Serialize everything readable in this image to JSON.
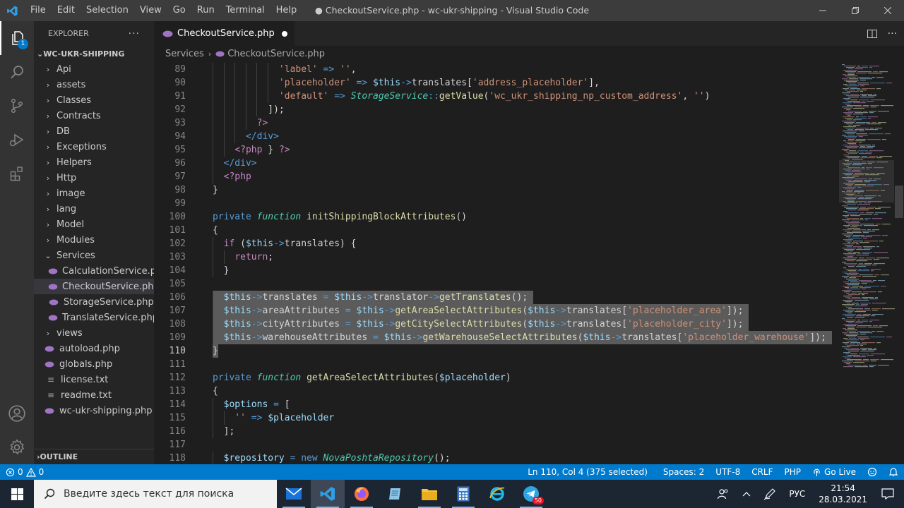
{
  "window": {
    "title": "● CheckoutService.php - wc-ukr-shipping - Visual Studio Code",
    "menu": [
      "File",
      "Edit",
      "Selection",
      "View",
      "Go",
      "Run",
      "Terminal",
      "Help"
    ]
  },
  "activity": {
    "explorer_badge": "1"
  },
  "sidebar": {
    "header": "EXPLORER",
    "more": "···",
    "root": "WC-UKR-SHIPPING",
    "items": [
      {
        "label": "Api",
        "type": "folder"
      },
      {
        "label": "assets",
        "type": "folder"
      },
      {
        "label": "Classes",
        "type": "folder"
      },
      {
        "label": "Contracts",
        "type": "folder"
      },
      {
        "label": "DB",
        "type": "folder"
      },
      {
        "label": "Exceptions",
        "type": "folder"
      },
      {
        "label": "Helpers",
        "type": "folder"
      },
      {
        "label": "Http",
        "type": "folder"
      },
      {
        "label": "image",
        "type": "folder"
      },
      {
        "label": "lang",
        "type": "folder"
      },
      {
        "label": "Model",
        "type": "folder"
      },
      {
        "label": "Modules",
        "type": "folder"
      },
      {
        "label": "Services",
        "type": "folder-open"
      },
      {
        "label": "CalculationService.p...",
        "type": "php-child"
      },
      {
        "label": "CheckoutService.php",
        "type": "php-child",
        "selected": true
      },
      {
        "label": "StorageService.php",
        "type": "php-child"
      },
      {
        "label": "TranslateService.php",
        "type": "php-child"
      },
      {
        "label": "views",
        "type": "folder"
      },
      {
        "label": "autoload.php",
        "type": "php"
      },
      {
        "label": "globals.php",
        "type": "php"
      },
      {
        "label": "license.txt",
        "type": "txt"
      },
      {
        "label": "readme.txt",
        "type": "txt"
      },
      {
        "label": "wc-ukr-shipping.php",
        "type": "php"
      }
    ],
    "outline": "OUTLINE"
  },
  "editor": {
    "tab_label": "CheckoutService.php",
    "breadcrumb": [
      "Services",
      "CheckoutService.php"
    ],
    "current_line": 110,
    "lines": [
      {
        "n": 89,
        "i": 6,
        "s": false,
        "t": [
          [
            "str",
            "'label'"
          ],
          [
            "op",
            " "
          ],
          [
            "kw",
            "=>"
          ],
          [
            "op",
            " "
          ],
          [
            "str",
            "''"
          ],
          [
            "op",
            ","
          ]
        ]
      },
      {
        "n": 90,
        "i": 6,
        "s": false,
        "t": [
          [
            "str",
            "'placeholder'"
          ],
          [
            "op",
            " "
          ],
          [
            "kw",
            "=>"
          ],
          [
            "op",
            " "
          ],
          [
            "var",
            "$this"
          ],
          [
            "kw",
            "->"
          ],
          [
            "op",
            "translates["
          ],
          [
            "str",
            "'address_placeholder'"
          ],
          [
            "op",
            "],"
          ]
        ]
      },
      {
        "n": 91,
        "i": 6,
        "s": false,
        "t": [
          [
            "str",
            "'default'"
          ],
          [
            "op",
            " "
          ],
          [
            "kw",
            "=>"
          ],
          [
            "op",
            " "
          ],
          [
            "cls",
            "StorageService"
          ],
          [
            "kw",
            "::"
          ],
          [
            "fn",
            "getValue"
          ],
          [
            "op",
            "("
          ],
          [
            "str",
            "'wc_ukr_shipping_np_custom_address'"
          ],
          [
            "op",
            ", "
          ],
          [
            "str",
            "''"
          ],
          [
            "op",
            ")"
          ]
        ]
      },
      {
        "n": 92,
        "i": 5,
        "s": false,
        "t": [
          [
            "op",
            "]);"
          ]
        ]
      },
      {
        "n": 93,
        "i": 4,
        "s": false,
        "t": [
          [
            "ctl",
            "?>"
          ]
        ]
      },
      {
        "n": 94,
        "i": 3,
        "s": false,
        "t": [
          [
            "tag",
            "</div>"
          ]
        ]
      },
      {
        "n": 95,
        "i": 2,
        "s": false,
        "t": [
          [
            "ctl",
            "<?php"
          ],
          [
            "op",
            " } "
          ],
          [
            "ctl",
            "?>"
          ]
        ]
      },
      {
        "n": 96,
        "i": 1,
        "s": false,
        "t": [
          [
            "tag",
            "</div>"
          ]
        ]
      },
      {
        "n": 97,
        "i": 1,
        "s": false,
        "t": [
          [
            "ctl",
            "<?php"
          ]
        ]
      },
      {
        "n": 98,
        "i": 0,
        "s": false,
        "t": [
          [
            "op",
            "}"
          ]
        ]
      },
      {
        "n": 99,
        "i": 0,
        "s": false,
        "t": []
      },
      {
        "n": 100,
        "i": 0,
        "s": false,
        "t": [
          [
            "kw",
            "private"
          ],
          [
            "op",
            " "
          ],
          [
            "cls",
            "function"
          ],
          [
            "op",
            " "
          ],
          [
            "fn",
            "initShippingBlockAttributes"
          ],
          [
            "op",
            "()"
          ]
        ]
      },
      {
        "n": 101,
        "i": 0,
        "s": false,
        "t": [
          [
            "op",
            "{"
          ]
        ]
      },
      {
        "n": 102,
        "i": 1,
        "s": false,
        "t": [
          [
            "ctl",
            "if"
          ],
          [
            "op",
            " ("
          ],
          [
            "var",
            "$this"
          ],
          [
            "kw",
            "->"
          ],
          [
            "op",
            "translates) {"
          ]
        ]
      },
      {
        "n": 103,
        "i": 2,
        "s": false,
        "t": [
          [
            "ctl",
            "return"
          ],
          [
            "op",
            ";"
          ]
        ]
      },
      {
        "n": 104,
        "i": 1,
        "s": false,
        "t": [
          [
            "op",
            "}"
          ]
        ]
      },
      {
        "n": 105,
        "i": 0,
        "s": false,
        "t": []
      },
      {
        "n": 106,
        "i": 1,
        "s": true,
        "t": [
          [
            "var",
            "$this"
          ],
          [
            "kw",
            "->"
          ],
          [
            "op",
            "translates "
          ],
          [
            "kw",
            "="
          ],
          [
            "op",
            " "
          ],
          [
            "var",
            "$this"
          ],
          [
            "kw",
            "->"
          ],
          [
            "op",
            "translator"
          ],
          [
            "kw",
            "->"
          ],
          [
            "fn",
            "getTranslates"
          ],
          [
            "op",
            "();"
          ]
        ]
      },
      {
        "n": 107,
        "i": 1,
        "s": true,
        "t": [
          [
            "var",
            "$this"
          ],
          [
            "kw",
            "->"
          ],
          [
            "op",
            "areaAttributes "
          ],
          [
            "kw",
            "="
          ],
          [
            "op",
            " "
          ],
          [
            "var",
            "$this"
          ],
          [
            "kw",
            "->"
          ],
          [
            "fn",
            "getAreaSelectAttributes"
          ],
          [
            "op",
            "("
          ],
          [
            "var",
            "$this"
          ],
          [
            "kw",
            "->"
          ],
          [
            "op",
            "translates["
          ],
          [
            "str",
            "'placeholder_area'"
          ],
          [
            "op",
            "]);"
          ]
        ]
      },
      {
        "n": 108,
        "i": 1,
        "s": true,
        "t": [
          [
            "var",
            "$this"
          ],
          [
            "kw",
            "->"
          ],
          [
            "op",
            "cityAttributes "
          ],
          [
            "kw",
            "="
          ],
          [
            "op",
            " "
          ],
          [
            "var",
            "$this"
          ],
          [
            "kw",
            "->"
          ],
          [
            "fn",
            "getCitySelectAttributes"
          ],
          [
            "op",
            "("
          ],
          [
            "var",
            "$this"
          ],
          [
            "kw",
            "->"
          ],
          [
            "op",
            "translates["
          ],
          [
            "str",
            "'placeholder_city'"
          ],
          [
            "op",
            "]);"
          ]
        ]
      },
      {
        "n": 109,
        "i": 1,
        "s": true,
        "t": [
          [
            "var",
            "$this"
          ],
          [
            "kw",
            "->"
          ],
          [
            "op",
            "warehouseAttributes "
          ],
          [
            "kw",
            "="
          ],
          [
            "op",
            " "
          ],
          [
            "var",
            "$this"
          ],
          [
            "kw",
            "->"
          ],
          [
            "fn",
            "getWarehouseSelectAttributes"
          ],
          [
            "op",
            "("
          ],
          [
            "var",
            "$this"
          ],
          [
            "kw",
            "->"
          ],
          [
            "op",
            "translates["
          ],
          [
            "str",
            "'placeholder_warehouse'"
          ],
          [
            "op",
            "]);"
          ]
        ]
      },
      {
        "n": 110,
        "i": 0,
        "s": true,
        "t": [
          [
            "op",
            "}"
          ]
        ]
      },
      {
        "n": 111,
        "i": 0,
        "s": false,
        "t": []
      },
      {
        "n": 112,
        "i": 0,
        "s": false,
        "t": [
          [
            "kw",
            "private"
          ],
          [
            "op",
            " "
          ],
          [
            "cls",
            "function"
          ],
          [
            "op",
            " "
          ],
          [
            "fn",
            "getAreaSelectAttributes"
          ],
          [
            "op",
            "("
          ],
          [
            "var",
            "$placeholder"
          ],
          [
            "op",
            ")"
          ]
        ]
      },
      {
        "n": 113,
        "i": 0,
        "s": false,
        "t": [
          [
            "op",
            "{"
          ]
        ]
      },
      {
        "n": 114,
        "i": 1,
        "s": false,
        "t": [
          [
            "var",
            "$options"
          ],
          [
            "op",
            " "
          ],
          [
            "kw",
            "="
          ],
          [
            "op",
            " ["
          ]
        ]
      },
      {
        "n": 115,
        "i": 2,
        "s": false,
        "t": [
          [
            "str",
            "''"
          ],
          [
            "op",
            " "
          ],
          [
            "kw",
            "=>"
          ],
          [
            "op",
            " "
          ],
          [
            "var",
            "$placeholder"
          ]
        ]
      },
      {
        "n": 116,
        "i": 1,
        "s": false,
        "t": [
          [
            "op",
            "];"
          ]
        ]
      },
      {
        "n": 117,
        "i": 0,
        "s": false,
        "t": []
      },
      {
        "n": 118,
        "i": 1,
        "s": false,
        "t": [
          [
            "var",
            "$repository"
          ],
          [
            "op",
            " "
          ],
          [
            "kw",
            "="
          ],
          [
            "op",
            " "
          ],
          [
            "kw",
            "new"
          ],
          [
            "op",
            " "
          ],
          [
            "cls",
            "NovaPoshtaRepository"
          ],
          [
            "op",
            "();"
          ]
        ]
      }
    ]
  },
  "statusbar": {
    "errors": "0",
    "warnings": "0",
    "position": "Ln 110, Col 4 (375 selected)",
    "spaces": "Spaces: 2",
    "encoding": "UTF-8",
    "eol": "CRLF",
    "language": "PHP",
    "golive": "Go Live"
  },
  "taskbar": {
    "search_placeholder": "Введите здесь текст для поиска",
    "lang": "РУС",
    "time": "21:54",
    "date": "28.03.2021",
    "telegram_badge": "50"
  }
}
